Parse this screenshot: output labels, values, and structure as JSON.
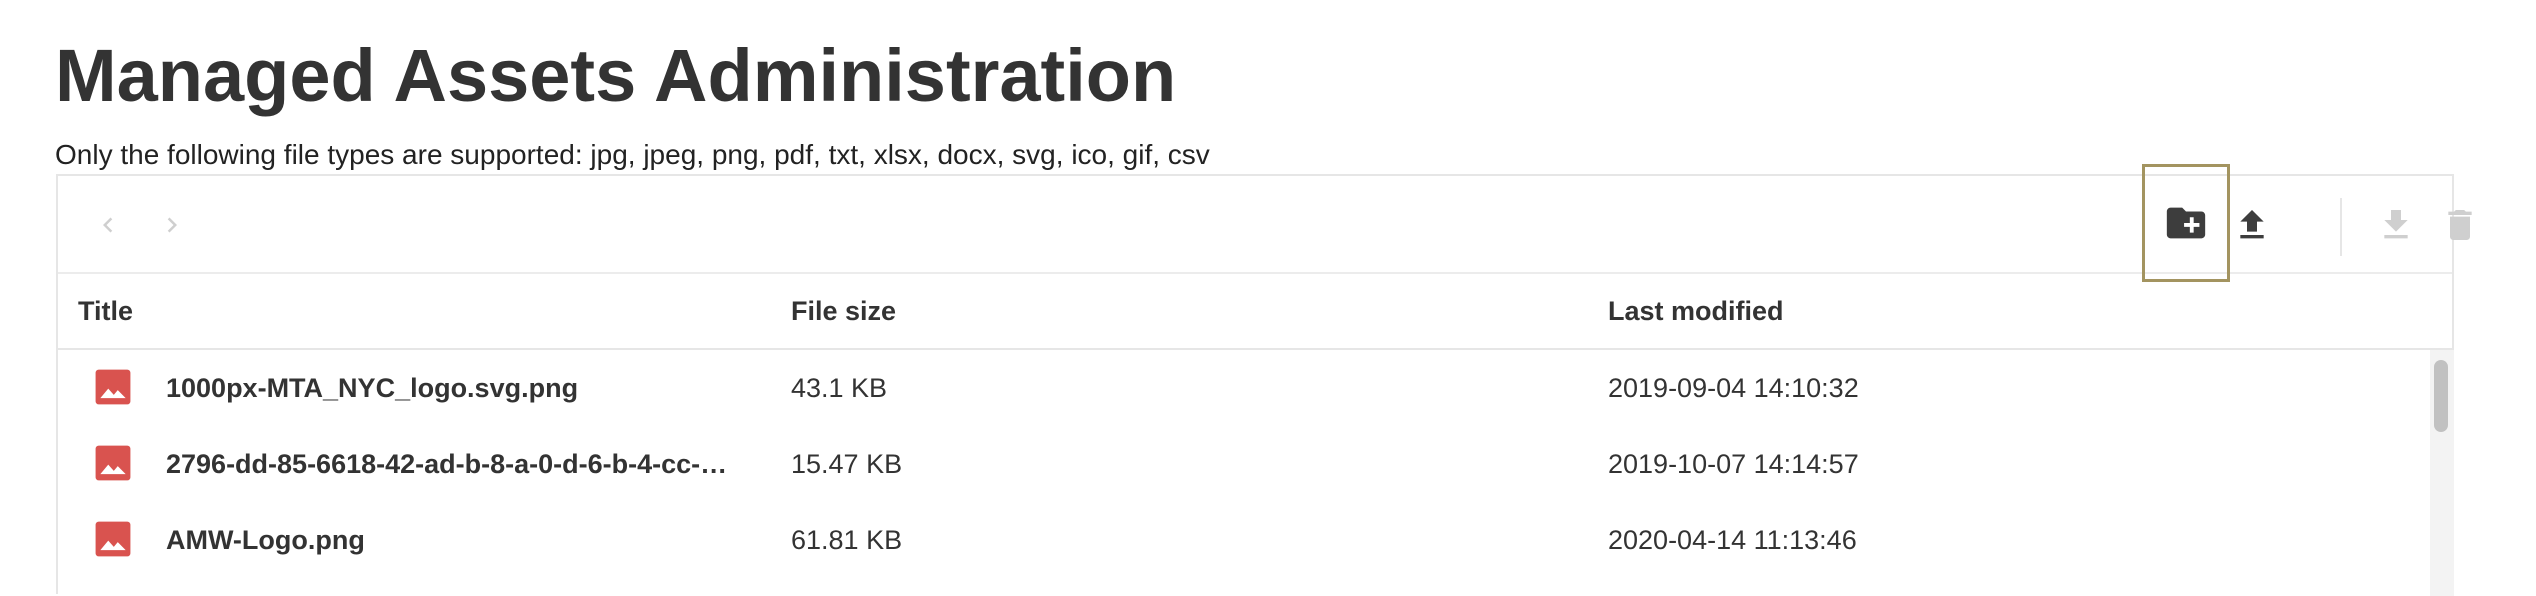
{
  "page": {
    "title": "Managed Assets Administration",
    "supported_types": "Only the following file types are supported: jpg, jpeg, png, pdf, txt, xlsx, docx, svg, ico, gif, csv"
  },
  "toolbar": {
    "back_icon": "chevron-left-icon",
    "forward_icon": "chevron-right-icon",
    "new_folder_icon": "folder-plus-icon",
    "upload_icon": "upload-icon",
    "download_icon": "download-icon",
    "delete_icon": "trash-icon"
  },
  "table": {
    "columns": [
      "Title",
      "File size",
      "Last modified"
    ],
    "rows": [
      {
        "title": "1000px-MTA_NYC_logo.svg.png",
        "size": "43.1 KB",
        "modified": "2019-09-04 14:10:32",
        "icon": "image-file-icon"
      },
      {
        "title": "2796-dd-85-6618-42-ad-b-8-a-0-d-6-b-4-cc-…",
        "size": "15.47 KB",
        "modified": "2019-10-07 14:14:57",
        "icon": "image-file-icon"
      },
      {
        "title": "AMW-Logo.png",
        "size": "61.81 KB",
        "modified": "2020-04-14 11:13:46",
        "icon": "image-file-icon"
      }
    ]
  },
  "colors": {
    "text": "#333333",
    "image_icon": "#d9534f",
    "disabled_icon": "#cfcfcf",
    "active_icon": "#3d3d3d",
    "highlight_border": "#a39460"
  }
}
